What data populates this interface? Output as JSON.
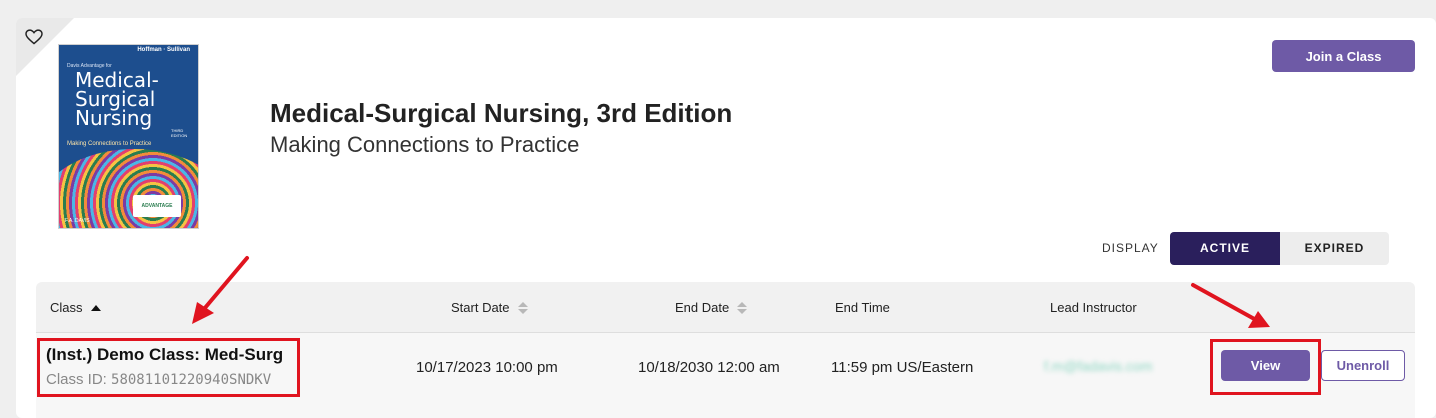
{
  "book": {
    "title": "Medical-Surgical Nursing, 3rd Edition",
    "subtitle": "Making Connections to Practice",
    "cover": {
      "authors": "Hoffman · Sullivan",
      "series": "Davis Advantage for",
      "title": "Medical-\nSurgical\nNursing",
      "edition": "THIRD EDITION",
      "subtitle": "Making Connections to Practice",
      "badge": "ADVANTAGE",
      "publisher": "F.A. DAVIS"
    }
  },
  "header": {
    "favorite_icon": "heart-outline-icon",
    "join_label": "Join a Class"
  },
  "display": {
    "label": "DISPLAY",
    "options": [
      "ACTIVE",
      "EXPIRED"
    ],
    "selected": "ACTIVE"
  },
  "table": {
    "columns": [
      "Class",
      "Start Date",
      "End Date",
      "End Time",
      "Lead Instructor"
    ],
    "rows": [
      {
        "class_name": "(Inst.) Demo Class: Med-Surg",
        "class_id_label": "Class ID: ",
        "class_id": "58081101220940SNDKV",
        "start_date": "10/17/2023 10:00 pm",
        "end_date": "10/18/2030 12:00 am",
        "end_time": "11:59 pm US/Eastern",
        "lead_instructor": "f.m@fadavis.com",
        "view_label": "View",
        "unenroll_label": "Unenroll"
      }
    ]
  },
  "colors": {
    "accent": "#6e5aa6",
    "toggle_active": "#2a1f5c",
    "highlight": "#e0141f"
  }
}
